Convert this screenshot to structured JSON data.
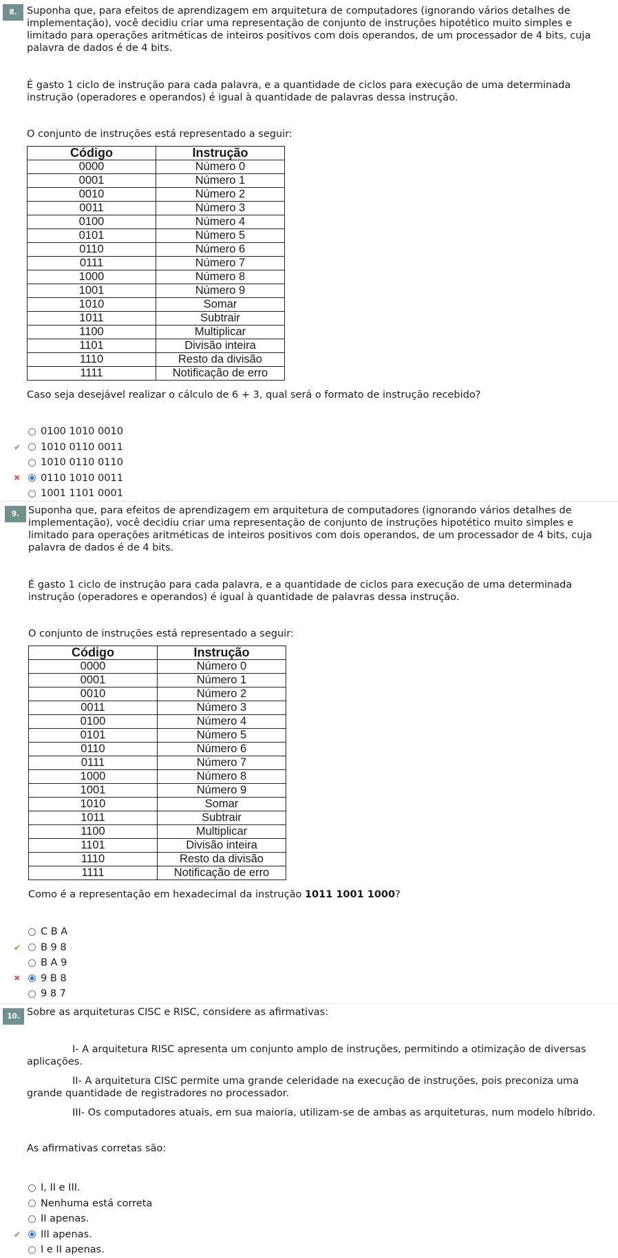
{
  "intro": [
    "Suponha que, para efeitos de aprendizagem em arquitetura de computadores (ignorando vários detalhes de implementação), você decidiu criar uma representação de conjunto de instruções hipotético muito simples e limitado para operações aritméticas de inteiros positivos com dois operandos, de um processador de 4 bits, cuja palavra de dados é de 4 bits.",
    "É gasto 1 ciclo de instrução para cada palavra, e a quantidade de ciclos para execução de uma determinada instrução (operadores e operandos) é igual à quantidade de palavras dessa instrução.",
    "O conjunto de instruções está representado a seguir:"
  ],
  "table": {
    "headers": [
      "Código",
      "Instrução"
    ],
    "rows": [
      [
        "0000",
        "Número 0"
      ],
      [
        "0001",
        "Número 1"
      ],
      [
        "0010",
        "Número 2"
      ],
      [
        "0011",
        "Número 3"
      ],
      [
        "0100",
        "Número 4"
      ],
      [
        "0101",
        "Número 5"
      ],
      [
        "0110",
        "Número 6"
      ],
      [
        "0111",
        "Número 7"
      ],
      [
        "1000",
        "Número 8"
      ],
      [
        "1001",
        "Número 9"
      ],
      [
        "1010",
        "Somar"
      ],
      [
        "1011",
        "Subtrair"
      ],
      [
        "1100",
        "Multiplicar"
      ],
      [
        "1101",
        "Divisão inteira"
      ],
      [
        "1110",
        "Resto da divisão"
      ],
      [
        "1111",
        "Notificação de erro"
      ]
    ]
  },
  "q8": {
    "number": "8.",
    "question": "Caso seja desejável realizar o cálculo de 6 + 3, qual será o formato de instrução recebido?",
    "options": [
      {
        "label": "0100 1010 0010",
        "checked": false,
        "mark": ""
      },
      {
        "label": "1010 0110 0011",
        "checked": false,
        "mark": "correct"
      },
      {
        "label": "1010 0110 0110",
        "checked": false,
        "mark": ""
      },
      {
        "label": "0110 1010 0011",
        "checked": true,
        "mark": "wrong"
      },
      {
        "label": "1001 1101 0001",
        "checked": false,
        "mark": ""
      }
    ]
  },
  "q9": {
    "number": "9.",
    "question_prefix": "Como é a representação em hexadecimal da instrução ",
    "question_bold": "1011 1001 1000",
    "question_suffix": "?",
    "options": [
      {
        "label": "C B A",
        "checked": false,
        "mark": ""
      },
      {
        "label": "B 9 8",
        "checked": false,
        "mark": "correct"
      },
      {
        "label": "B A 9",
        "checked": false,
        "mark": ""
      },
      {
        "label": "9 B 8",
        "checked": true,
        "mark": "wrong"
      },
      {
        "label": "9 8 7",
        "checked": false,
        "mark": ""
      }
    ]
  },
  "q10": {
    "number": "10.",
    "intro": "Sobre as arquiteturas CISC e RISC, considere as afirmativas:",
    "statements": [
      "I- A arquitetura RISC apresenta um conjunto amplo de instruções, permitindo a otimização de diversas aplicações.",
      "II- A arquitetura CISC permite uma grande celeridade na execução de instruções, pois preconiza uma grande quantidade de registradores no processador.",
      "III- Os computadores atuais, em sua maioria, utilizam-se de ambas as arquiteturas, num modelo híbrido."
    ],
    "question": "As afirmativas corretas são:",
    "options": [
      {
        "label": "I, II e III.",
        "checked": false,
        "mark": ""
      },
      {
        "label": "Nenhuma está correta",
        "checked": false,
        "mark": ""
      },
      {
        "label": "II apenas.",
        "checked": false,
        "mark": ""
      },
      {
        "label": "III apenas.",
        "checked": true,
        "mark": "correct"
      },
      {
        "label": "I e II apenas.",
        "checked": false,
        "mark": ""
      }
    ]
  },
  "icons": {
    "correct": "check-icon",
    "wrong": "cross-icon",
    "correct_color": "#6aa84f",
    "wrong_color": "#d25b5b"
  }
}
